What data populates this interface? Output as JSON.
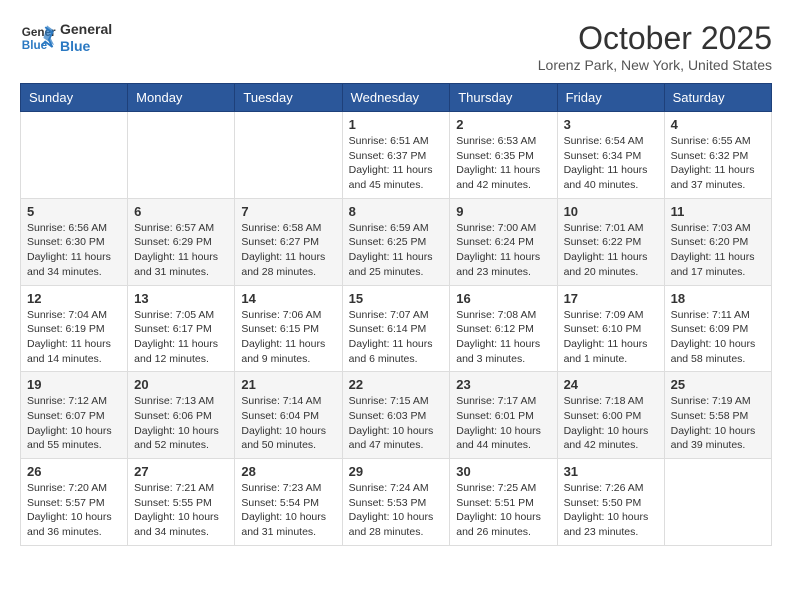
{
  "header": {
    "logo_line1": "General",
    "logo_line2": "Blue",
    "month_title": "October 2025",
    "location": "Lorenz Park, New York, United States"
  },
  "weekdays": [
    "Sunday",
    "Monday",
    "Tuesday",
    "Wednesday",
    "Thursday",
    "Friday",
    "Saturday"
  ],
  "weeks": [
    [
      {
        "day": "",
        "info": ""
      },
      {
        "day": "",
        "info": ""
      },
      {
        "day": "",
        "info": ""
      },
      {
        "day": "1",
        "info": "Sunrise: 6:51 AM\nSunset: 6:37 PM\nDaylight: 11 hours and 45 minutes."
      },
      {
        "day": "2",
        "info": "Sunrise: 6:53 AM\nSunset: 6:35 PM\nDaylight: 11 hours and 42 minutes."
      },
      {
        "day": "3",
        "info": "Sunrise: 6:54 AM\nSunset: 6:34 PM\nDaylight: 11 hours and 40 minutes."
      },
      {
        "day": "4",
        "info": "Sunrise: 6:55 AM\nSunset: 6:32 PM\nDaylight: 11 hours and 37 minutes."
      }
    ],
    [
      {
        "day": "5",
        "info": "Sunrise: 6:56 AM\nSunset: 6:30 PM\nDaylight: 11 hours and 34 minutes."
      },
      {
        "day": "6",
        "info": "Sunrise: 6:57 AM\nSunset: 6:29 PM\nDaylight: 11 hours and 31 minutes."
      },
      {
        "day": "7",
        "info": "Sunrise: 6:58 AM\nSunset: 6:27 PM\nDaylight: 11 hours and 28 minutes."
      },
      {
        "day": "8",
        "info": "Sunrise: 6:59 AM\nSunset: 6:25 PM\nDaylight: 11 hours and 25 minutes."
      },
      {
        "day": "9",
        "info": "Sunrise: 7:00 AM\nSunset: 6:24 PM\nDaylight: 11 hours and 23 minutes."
      },
      {
        "day": "10",
        "info": "Sunrise: 7:01 AM\nSunset: 6:22 PM\nDaylight: 11 hours and 20 minutes."
      },
      {
        "day": "11",
        "info": "Sunrise: 7:03 AM\nSunset: 6:20 PM\nDaylight: 11 hours and 17 minutes."
      }
    ],
    [
      {
        "day": "12",
        "info": "Sunrise: 7:04 AM\nSunset: 6:19 PM\nDaylight: 11 hours and 14 minutes."
      },
      {
        "day": "13",
        "info": "Sunrise: 7:05 AM\nSunset: 6:17 PM\nDaylight: 11 hours and 12 minutes."
      },
      {
        "day": "14",
        "info": "Sunrise: 7:06 AM\nSunset: 6:15 PM\nDaylight: 11 hours and 9 minutes."
      },
      {
        "day": "15",
        "info": "Sunrise: 7:07 AM\nSunset: 6:14 PM\nDaylight: 11 hours and 6 minutes."
      },
      {
        "day": "16",
        "info": "Sunrise: 7:08 AM\nSunset: 6:12 PM\nDaylight: 11 hours and 3 minutes."
      },
      {
        "day": "17",
        "info": "Sunrise: 7:09 AM\nSunset: 6:10 PM\nDaylight: 11 hours and 1 minute."
      },
      {
        "day": "18",
        "info": "Sunrise: 7:11 AM\nSunset: 6:09 PM\nDaylight: 10 hours and 58 minutes."
      }
    ],
    [
      {
        "day": "19",
        "info": "Sunrise: 7:12 AM\nSunset: 6:07 PM\nDaylight: 10 hours and 55 minutes."
      },
      {
        "day": "20",
        "info": "Sunrise: 7:13 AM\nSunset: 6:06 PM\nDaylight: 10 hours and 52 minutes."
      },
      {
        "day": "21",
        "info": "Sunrise: 7:14 AM\nSunset: 6:04 PM\nDaylight: 10 hours and 50 minutes."
      },
      {
        "day": "22",
        "info": "Sunrise: 7:15 AM\nSunset: 6:03 PM\nDaylight: 10 hours and 47 minutes."
      },
      {
        "day": "23",
        "info": "Sunrise: 7:17 AM\nSunset: 6:01 PM\nDaylight: 10 hours and 44 minutes."
      },
      {
        "day": "24",
        "info": "Sunrise: 7:18 AM\nSunset: 6:00 PM\nDaylight: 10 hours and 42 minutes."
      },
      {
        "day": "25",
        "info": "Sunrise: 7:19 AM\nSunset: 5:58 PM\nDaylight: 10 hours and 39 minutes."
      }
    ],
    [
      {
        "day": "26",
        "info": "Sunrise: 7:20 AM\nSunset: 5:57 PM\nDaylight: 10 hours and 36 minutes."
      },
      {
        "day": "27",
        "info": "Sunrise: 7:21 AM\nSunset: 5:55 PM\nDaylight: 10 hours and 34 minutes."
      },
      {
        "day": "28",
        "info": "Sunrise: 7:23 AM\nSunset: 5:54 PM\nDaylight: 10 hours and 31 minutes."
      },
      {
        "day": "29",
        "info": "Sunrise: 7:24 AM\nSunset: 5:53 PM\nDaylight: 10 hours and 28 minutes."
      },
      {
        "day": "30",
        "info": "Sunrise: 7:25 AM\nSunset: 5:51 PM\nDaylight: 10 hours and 26 minutes."
      },
      {
        "day": "31",
        "info": "Sunrise: 7:26 AM\nSunset: 5:50 PM\nDaylight: 10 hours and 23 minutes."
      },
      {
        "day": "",
        "info": ""
      }
    ]
  ]
}
